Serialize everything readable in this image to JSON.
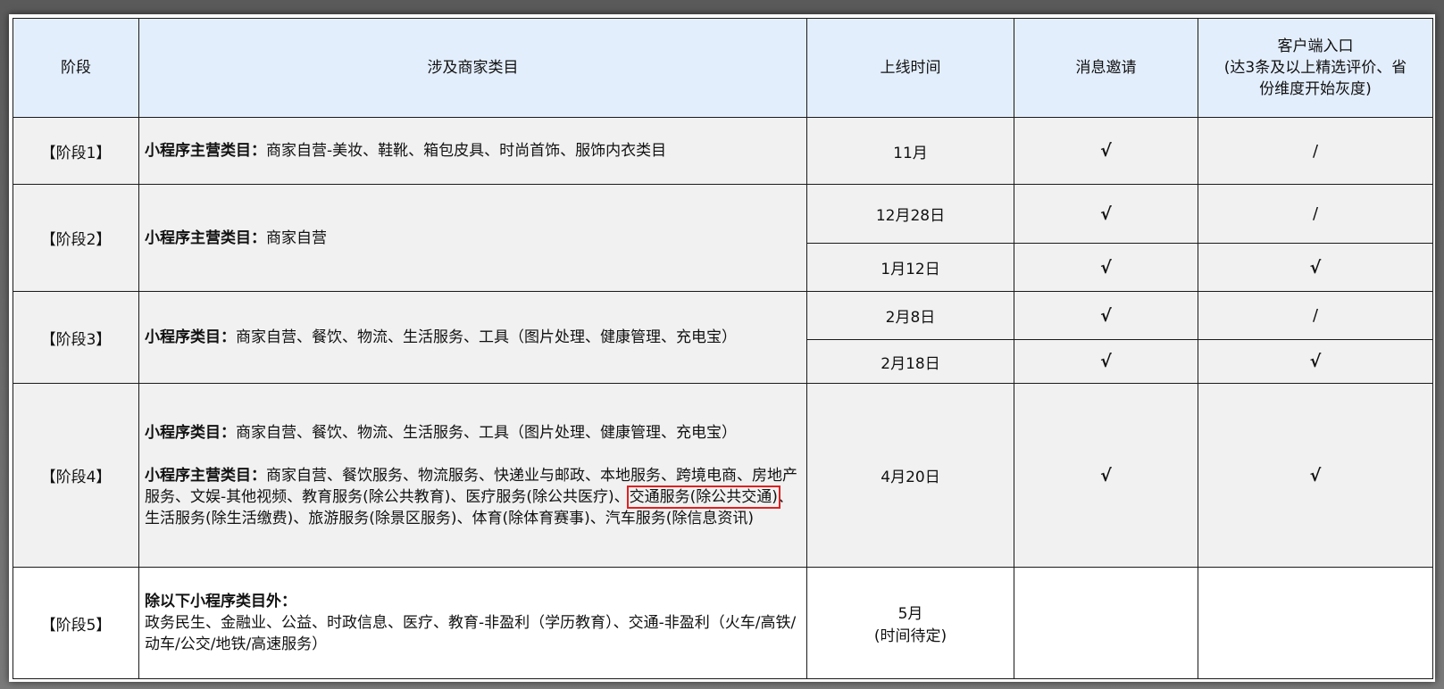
{
  "headers": {
    "stage": "阶段",
    "categories": "涉及商家类目",
    "launch": "上线时间",
    "msg_invite": "消息邀请",
    "client_entry_1": "客户端入口",
    "client_entry_2": "(达3条及以上精选评价、省",
    "client_entry_3": "份维度开始灰度)"
  },
  "rows": [
    {
      "stage": "【阶段1】",
      "label": "小程序主营类目：",
      "text": "商家自营-美妆、鞋靴、箱包皮具、时尚首饰、服饰内衣类目",
      "launch": "11月",
      "invite": "√",
      "entry": "/"
    },
    {
      "stage": "【阶段2】",
      "label": "小程序主营类目：",
      "text": "商家自营",
      "sub": [
        {
          "launch": "12月28日",
          "invite": "√",
          "entry": "/"
        },
        {
          "launch": "1月12日",
          "invite": "√",
          "entry": "√"
        }
      ]
    },
    {
      "stage": "【阶段3】",
      "label": "小程序类目：",
      "text": "商家自营、餐饮、物流、生活服务、工具（图片处理、健康管理、充电宝）",
      "sub": [
        {
          "launch": "2月8日",
          "invite": "√",
          "entry": "/"
        },
        {
          "launch": "2月18日",
          "invite": "√",
          "entry": "√"
        }
      ]
    },
    {
      "stage": "【阶段4】",
      "label1": "小程序类目：",
      "text1": "商家自营、餐饮、物流、生活服务、工具（图片处理、健康管理、充电宝）",
      "label2": "小程序主营类目：",
      "text2_a": "商家自营、餐饮服务、物流服务、快递业与邮政、本地服务、跨境电商、房地产服务、文娱-其他视频、教育服务(除公共教育)、医疗服务(除公共医疗)、",
      "text2_hl": "交通服务(除公共交通)",
      "text2_b": "、生活服务(除生活缴费)、旅游服务(除景区服务)、体育(除体育赛事)、汽车服务(除信息资讯)",
      "launch": "4月20日",
      "invite": "√",
      "entry": "√"
    },
    {
      "stage": "【阶段5】",
      "label": "除以下小程序类目外：",
      "text": "政务民生、金融业、公益、时政信息、医疗、教育-非盈利（学历教育）、交通-非盈利（火车/高铁/动车/公交/地铁/高速服务）",
      "launch_1": "5月",
      "launch_2": "(时间待定)",
      "invite": "",
      "entry": ""
    }
  ]
}
